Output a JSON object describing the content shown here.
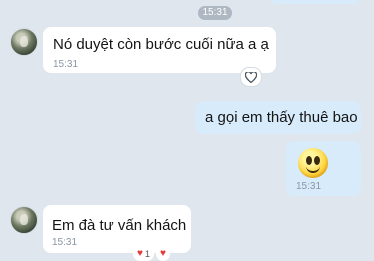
{
  "chat": {
    "top_time": "15:31",
    "messages": [
      {
        "text": "Nó duyệt còn bước cuối nữa a ạ",
        "time": "15:31"
      },
      {
        "text": "a gọi em thấy thuê bao"
      },
      {
        "sticker": "smiley-sticker",
        "time": "15:31"
      },
      {
        "text": "Em đà tư vấn khách",
        "time": "15:31"
      }
    ],
    "reactions": {
      "heart_count": "1"
    },
    "icons": {
      "react": "heart-outline-icon",
      "heart": "heart-icon"
    },
    "colors": {
      "incoming": "#ffffff",
      "outgoing": "#d7ebfb",
      "background": "#dfe6ee",
      "heart": "#e53935"
    }
  }
}
